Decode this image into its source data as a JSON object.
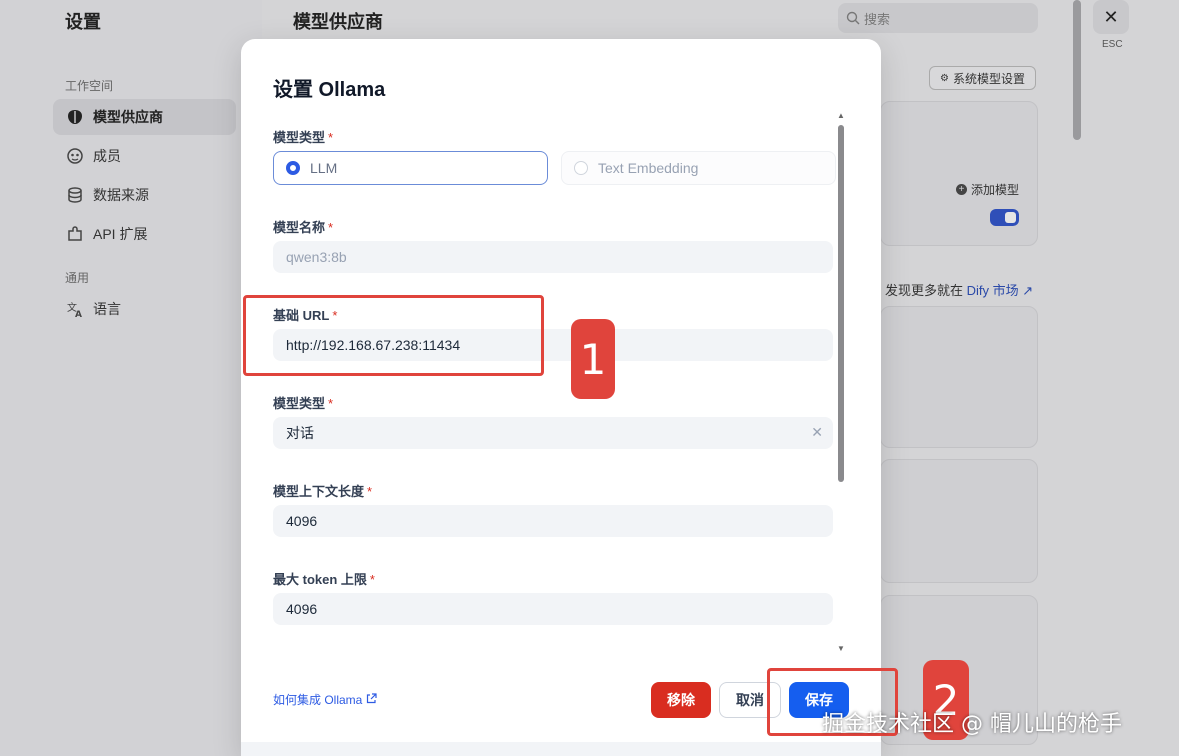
{
  "sidebar": {
    "title": "设置",
    "group_workspace": "工作空间",
    "items": [
      {
        "label": "模型供应商",
        "icon": "brain-icon",
        "active": true
      },
      {
        "label": "成员",
        "icon": "members-icon",
        "active": false
      },
      {
        "label": "数据来源",
        "icon": "database-icon",
        "active": false
      },
      {
        "label": "API 扩展",
        "icon": "puzzle-icon",
        "active": false
      }
    ],
    "group_general": "通用",
    "language_label": "语言"
  },
  "header": {
    "title": "模型供应商",
    "search_placeholder": "搜索",
    "esc_label": "ESC"
  },
  "background": {
    "system_model_settings": "系统模型设置",
    "add_model": "添加模型",
    "market_prefix": "发现更多就在",
    "market_link": "Dify 市场"
  },
  "modal": {
    "title": "设置 Ollama",
    "model_type_label": "模型类型",
    "model_type_options": [
      "LLM",
      "Text Embedding"
    ],
    "model_type_selected": "LLM",
    "model_name_label": "模型名称",
    "model_name_value": "qwen3:8b",
    "base_url_label": "基础 URL",
    "base_url_value": "http://192.168.67.238:11434",
    "mode_label": "模型类型",
    "mode_value": "对话",
    "context_length_label": "模型上下文长度",
    "context_length_value": "4096",
    "max_token_label": "最大 token 上限",
    "max_token_value": "4096",
    "help_link": "如何集成 Ollama",
    "remove_button": "移除",
    "cancel_button": "取消",
    "save_button": "保存",
    "required_mark": "*"
  },
  "annotations": {
    "badge_1": "1",
    "badge_2": "2",
    "color": "#e0443c"
  },
  "watermark": "掘金技术社区 @ 帽儿山的枪手",
  "colors": {
    "primary": "#155eef",
    "danger": "#d92d20",
    "toggle": "#2f4fb8"
  }
}
